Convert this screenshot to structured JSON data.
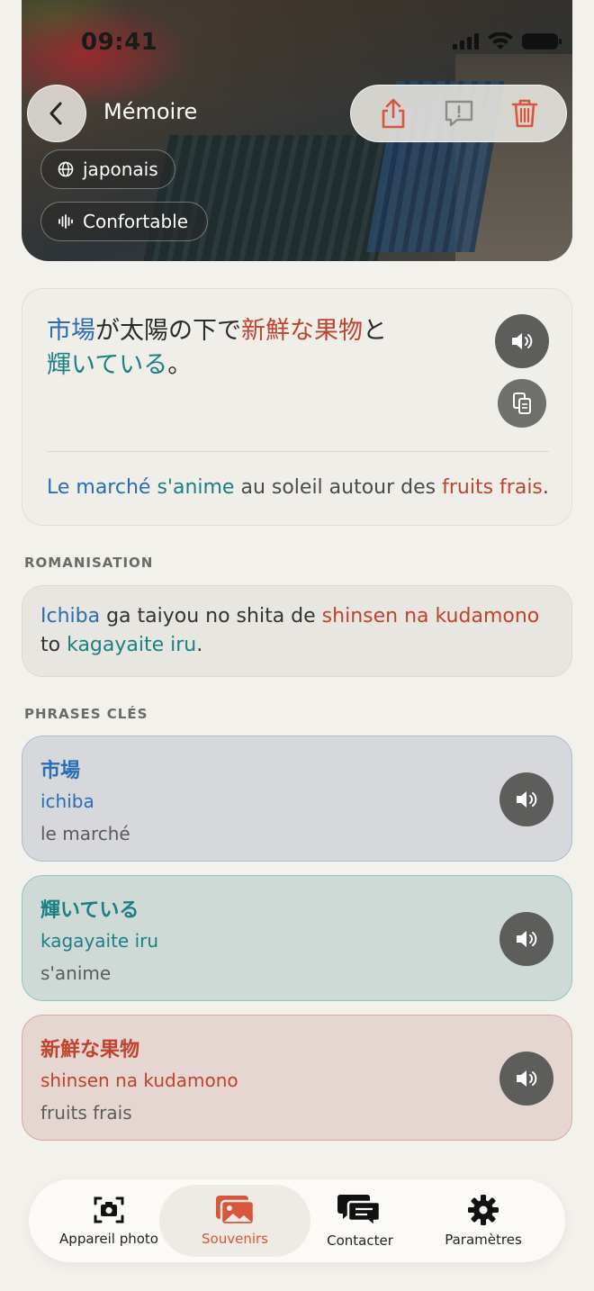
{
  "status_bar": {
    "time": "09:41"
  },
  "header": {
    "title": "Mémoire",
    "language_chip": "japonais",
    "level_chip": "Confortable",
    "icons": [
      "chevron-left-icon",
      "share-icon",
      "feedback-icon",
      "trash-icon"
    ]
  },
  "sentence": {
    "jp_segments": [
      {
        "text": "市場",
        "color": "blue"
      },
      {
        "text": "が太陽の下で",
        "color": "default"
      },
      {
        "text": "新鮮な果物",
        "color": "red"
      },
      {
        "text": "と",
        "color": "default"
      },
      {
        "text": "輝いている",
        "color": "teal"
      },
      {
        "text": "。",
        "color": "default"
      }
    ],
    "fr_segments": [
      {
        "text": "Le marché",
        "color": "blue"
      },
      {
        "text": " ",
        "color": "default"
      },
      {
        "text": "s'anime",
        "color": "teal"
      },
      {
        "text": " au soleil autour des ",
        "color": "default"
      },
      {
        "text": "fruits frais",
        "color": "red"
      },
      {
        "text": ".",
        "color": "default"
      }
    ]
  },
  "romanization": {
    "label": "ROMANISATION",
    "segments": [
      {
        "text": "Ichiba",
        "color": "blue"
      },
      {
        "text": " ga taiyou no shita de ",
        "color": "default"
      },
      {
        "text": "shinsen na kudamono",
        "color": "red"
      },
      {
        "text": " to ",
        "color": "default"
      },
      {
        "text": "kagayaite iru",
        "color": "teal"
      },
      {
        "text": ".",
        "color": "default"
      }
    ]
  },
  "key_phrases": {
    "label": "PHRASES CLÉS",
    "items": [
      {
        "jp": "市場",
        "romaji": "ichiba",
        "fr": "le marché"
      },
      {
        "jp": "輝いている",
        "romaji": "kagayaite iru",
        "fr": "s'anime"
      },
      {
        "jp": "新鮮な果物",
        "romaji": "shinsen na kudamono",
        "fr": "fruits frais"
      }
    ]
  },
  "tabs": [
    {
      "label": "Appareil photo",
      "icon": "camera-icon",
      "active": false
    },
    {
      "label": "Souvenirs",
      "icon": "photos-icon",
      "active": true
    },
    {
      "label": "Contacter",
      "icon": "chat-icon",
      "active": false
    },
    {
      "label": "Paramètres",
      "icon": "gear-icon",
      "active": false
    }
  ],
  "colors": {
    "blue": "#2a6db5",
    "teal": "#1b7f83",
    "red": "#c0432e",
    "active_tab": "#d9553c"
  }
}
